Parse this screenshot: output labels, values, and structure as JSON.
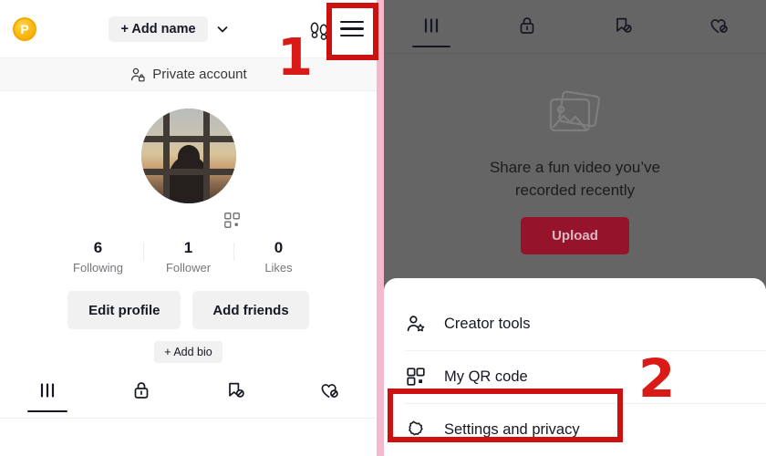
{
  "meta": {
    "app": "TikTok profile with side menu open",
    "accent_red": "#cc1111",
    "annotation_red": "#d91a16",
    "divider_pink": "#f3b8cd",
    "overlay_grey": "#656565",
    "chip_grey": "#f1f1f2",
    "upload_button_color": "#96132c",
    "coin_gold": "#fcb813"
  },
  "left_panel": {
    "topbar": {
      "coin_badge_label": "P",
      "coin_badge_icon": "coin-p-icon",
      "add_name_label": "+ Add name",
      "chevron_icon": "chevron-down-icon",
      "footprints_icon": "footprints-icon",
      "menu_icon": "hamburger-menu-icon"
    },
    "private_row": {
      "icon": "private-account-icon",
      "label": "Private account"
    },
    "avatar": {
      "icon": "avatar",
      "description": "sunset through window silhouette"
    },
    "qr_icon": "qr-code-icon",
    "stats": [
      {
        "num": "6",
        "cap": "Following"
      },
      {
        "num": "1",
        "cap": "Follower"
      },
      {
        "num": "0",
        "cap": "Likes"
      }
    ],
    "actions": {
      "edit_profile": "Edit profile",
      "add_friends": "Add friends",
      "add_bio": "+ Add bio"
    },
    "tabs": [
      {
        "icon": "grid-posts-icon",
        "active": true
      },
      {
        "icon": "lock-private-icon",
        "active": false
      },
      {
        "icon": "bookmark-hidden-icon",
        "active": false
      },
      {
        "icon": "heart-hidden-icon",
        "active": false
      }
    ]
  },
  "right_panel": {
    "tabs": [
      {
        "icon": "grid-posts-icon",
        "active": true
      },
      {
        "icon": "lock-private-icon",
        "active": false
      },
      {
        "icon": "bookmark-hidden-icon",
        "active": false
      },
      {
        "icon": "heart-hidden-icon",
        "active": false
      }
    ],
    "empty_state": {
      "icon": "photo-stack-icon",
      "line1": "Share a fun video you’ve",
      "line2": "recorded recently",
      "upload_label": "Upload"
    },
    "menu_sheet": {
      "items": [
        {
          "icon": "creator-tools-icon",
          "label": "Creator tools"
        },
        {
          "icon": "qr-code-icon",
          "label": "My QR code"
        },
        {
          "icon": "gear-settings-icon",
          "label": "Settings and privacy"
        }
      ]
    }
  },
  "annotations": [
    {
      "name": "step-1",
      "label": "1"
    },
    {
      "name": "step-2",
      "label": "2"
    }
  ]
}
